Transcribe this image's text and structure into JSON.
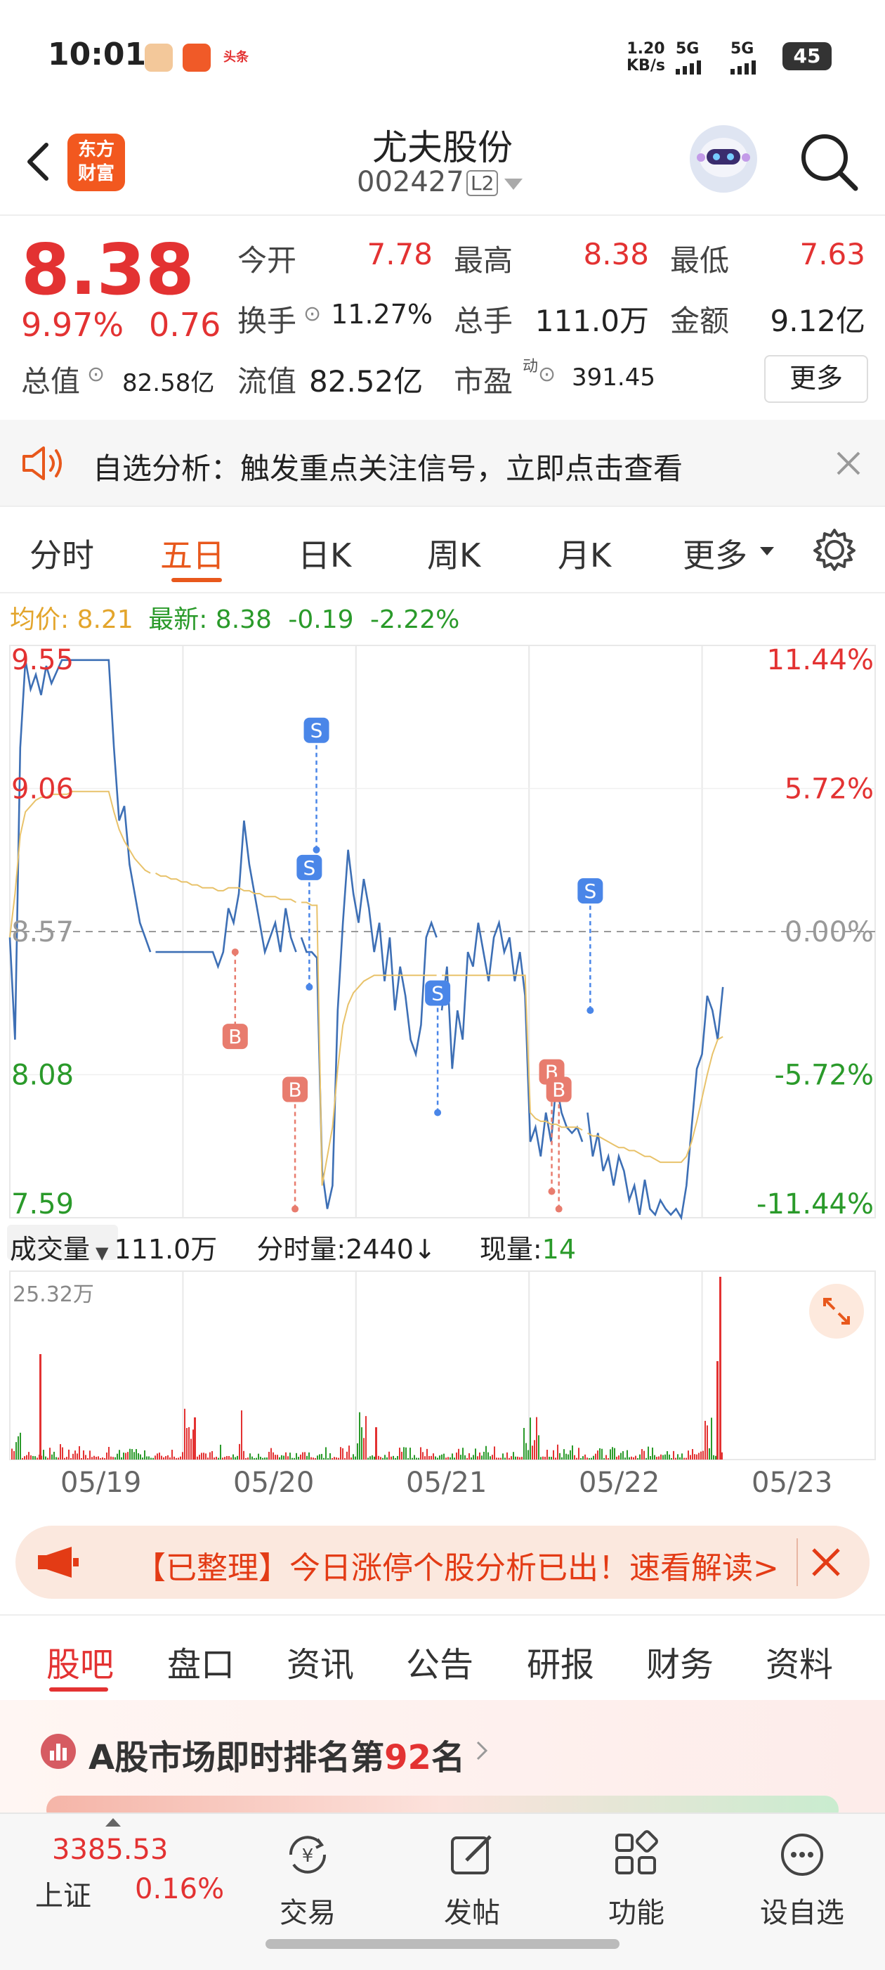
{
  "status": {
    "time": "10:01",
    "net_speed_value": "1.20",
    "net_speed_unit": "KB/s",
    "sim1": "5G",
    "sim2": "5G",
    "battery": "45",
    "app_icon3_text": "头条"
  },
  "header": {
    "logo_line1": "东方",
    "logo_line2": "财富",
    "stock_name": "尤夫股份",
    "stock_code": "002427",
    "level_badge": "L2"
  },
  "quote": {
    "price": "8.38",
    "change_pct": "9.97%",
    "change_abs": "0.76",
    "rows": [
      [
        {
          "label": "今开",
          "value": "7.78",
          "color": "red"
        },
        {
          "label": "最高",
          "value": "8.38",
          "color": "red"
        },
        {
          "label": "最低",
          "value": "7.63",
          "color": "red"
        }
      ],
      [
        {
          "label": "换手",
          "value": "11.27%",
          "color": "black"
        },
        {
          "label": "总手",
          "value": "111.0万",
          "color": "black"
        },
        {
          "label": "金额",
          "value": "9.12亿",
          "color": "black"
        }
      ]
    ],
    "total_value_label": "总值",
    "total_value": "82.58亿",
    "float_value_label": "流值",
    "float_value": "82.52亿",
    "pe_label": "市盈",
    "pe_sup": "动",
    "pe_value": "391.45",
    "more_label": "更多"
  },
  "alert": {
    "text": "自选分析：触发重点关注信号，立即点击查看"
  },
  "chart_tabs": [
    "分时",
    "五日",
    "日K",
    "周K",
    "月K",
    "更多"
  ],
  "chart_tab_active": 1,
  "chart_info": {
    "avg_label": "均价:",
    "avg_value": "8.21",
    "latest_label": "最新:",
    "latest_value": "8.38",
    "chg": "-0.19",
    "chg_pct": "-2.22%"
  },
  "volume_info": {
    "label": "成交量",
    "total": "111.0万",
    "bar_label": "分时量:",
    "bar_value": "2440",
    "arrow": "↓",
    "now_label": "现量:",
    "now_value": "14",
    "max_label": "25.32万"
  },
  "chart_data": {
    "type": "line",
    "y_left_ticks": [
      "9.55",
      "9.06",
      "8.57",
      "8.08",
      "7.59"
    ],
    "y_right_ticks": [
      "11.44%",
      "5.72%",
      "0.00%",
      "-5.72%",
      "-11.44%"
    ],
    "ylim": [
      7.59,
      9.55
    ],
    "prev_close": 8.57,
    "x_labels": [
      "05/19",
      "05/20",
      "05/21",
      "05/22",
      "05/23"
    ],
    "days": 5,
    "series": [
      {
        "values": [
          8.55,
          8.2,
          9.2,
          9.5,
          9.4,
          9.45,
          9.38,
          9.48,
          9.42,
          9.46,
          9.5,
          9.5,
          9.5,
          9.5,
          9.5,
          9.5,
          9.5,
          9.5,
          9.5,
          9.5,
          9.2,
          8.95,
          9.0,
          8.8,
          8.7,
          8.6,
          8.55,
          8.5,
          8.5,
          8.5,
          8.5,
          8.5,
          8.5,
          8.5,
          8.5,
          8.5,
          8.5,
          8.5,
          8.5,
          8.5,
          8.45,
          8.5,
          8.65,
          8.6,
          8.7,
          8.95,
          8.8,
          8.7,
          8.6,
          8.5,
          8.55,
          8.6,
          8.5,
          8.65,
          8.55,
          8.5,
          8.55,
          8.5,
          8.5,
          8.48,
          7.75,
          7.62,
          7.7,
          8.3,
          8.6,
          8.85,
          8.7,
          8.6,
          8.75,
          8.65,
          8.5,
          8.6,
          8.4,
          8.55,
          8.3,
          8.45,
          8.35,
          8.2,
          8.15,
          8.25,
          8.55,
          8.6,
          8.55,
          8.3,
          8.45,
          8.1,
          8.3,
          8.2,
          8.5,
          8.45,
          8.6,
          8.5,
          8.4,
          8.55,
          8.6,
          8.5,
          8.55,
          8.4,
          8.5,
          8.35,
          7.85,
          7.9,
          7.8,
          7.95,
          7.85,
          8.05,
          7.95,
          7.9,
          7.88,
          7.9,
          7.85,
          7.95,
          7.8,
          7.88,
          7.75,
          7.8,
          7.7,
          7.8,
          7.75,
          7.65,
          7.7,
          7.6,
          7.72,
          7.62,
          7.6,
          7.65,
          7.62,
          7.6,
          7.62,
          7.59,
          7.7,
          7.9,
          8.1,
          8.15,
          8.35,
          8.3,
          8.2,
          8.38
        ]
      },
      {
        "values": [
          8.55,
          8.7,
          8.9,
          8.98,
          9.0,
          9.02,
          9.03,
          9.03,
          9.04,
          9.04,
          9.04,
          9.04,
          9.05,
          9.05,
          9.05,
          9.05,
          9.05,
          9.05,
          9.05,
          9.05,
          8.98,
          8.92,
          8.88,
          8.85,
          8.82,
          8.8,
          8.78,
          8.77,
          8.77,
          8.76,
          8.76,
          8.75,
          8.75,
          8.74,
          8.74,
          8.73,
          8.73,
          8.72,
          8.72,
          8.72,
          8.71,
          8.71,
          8.72,
          8.72,
          8.72,
          8.71,
          8.71,
          8.7,
          8.7,
          8.69,
          8.69,
          8.69,
          8.68,
          8.68,
          8.68,
          8.67,
          8.67,
          8.67,
          8.66,
          8.66,
          7.7,
          7.8,
          7.9,
          8.1,
          8.25,
          8.32,
          8.36,
          8.38,
          8.4,
          8.41,
          8.42,
          8.42,
          8.42,
          8.42,
          8.42,
          8.42,
          8.42,
          8.42,
          8.42,
          8.42,
          8.42,
          8.42,
          8.42,
          8.42,
          8.42,
          8.42,
          8.42,
          8.42,
          8.42,
          8.42,
          8.42,
          8.42,
          8.42,
          8.42,
          8.42,
          8.42,
          8.42,
          8.42,
          8.42,
          8.42,
          7.95,
          7.93,
          7.92,
          7.92,
          7.91,
          7.91,
          7.9,
          7.9,
          7.9,
          7.9,
          7.89,
          7.88,
          7.87,
          7.87,
          7.86,
          7.85,
          7.84,
          7.83,
          7.83,
          7.82,
          7.82,
          7.81,
          7.8,
          7.8,
          7.79,
          7.78,
          7.78,
          7.78,
          7.78,
          7.78,
          7.8,
          7.85,
          7.92,
          8.0,
          8.08,
          8.15,
          8.2,
          8.21
        ]
      }
    ],
    "markers": [
      {
        "label": "B",
        "day": 1.58,
        "price": 8.5,
        "color": "#e87c6e",
        "dir": "down"
      },
      {
        "label": "B",
        "day": 2.0,
        "price": 7.62,
        "color": "#e87c6e",
        "dir": "up"
      },
      {
        "label": "S",
        "day": 2.15,
        "price": 8.85,
        "color": "#4a86e8",
        "dir": "up"
      },
      {
        "label": "S",
        "day": 2.1,
        "price": 8.38,
        "color": "#4a86e8",
        "dir": "up"
      },
      {
        "label": "S",
        "day": 3.0,
        "price": 7.95,
        "color": "#4a86e8",
        "dir": "up"
      },
      {
        "label": "B",
        "day": 3.8,
        "price": 7.68,
        "color": "#e87c6e",
        "dir": "up"
      },
      {
        "label": "B",
        "day": 3.85,
        "price": 7.62,
        "color": "#e87c6e",
        "dir": "up"
      },
      {
        "label": "S",
        "day": 4.07,
        "price": 8.3,
        "color": "#4a86e8",
        "dir": "up"
      }
    ]
  },
  "banner": {
    "text": "【已整理】今日涨停个股分析已出！速看解读>"
  },
  "sub_tabs": [
    "股吧",
    "盘口",
    "资讯",
    "公告",
    "研报",
    "财务",
    "资料"
  ],
  "sub_tab_active": 0,
  "rank": {
    "prefix": "A股市场即时排名第",
    "number": "92",
    "suffix": "名"
  },
  "bottom_nav": {
    "index_value": "3385.53",
    "index_name": "上证",
    "index_change": "0.16%",
    "items": [
      "交易",
      "发帖",
      "功能",
      "设自选"
    ]
  }
}
